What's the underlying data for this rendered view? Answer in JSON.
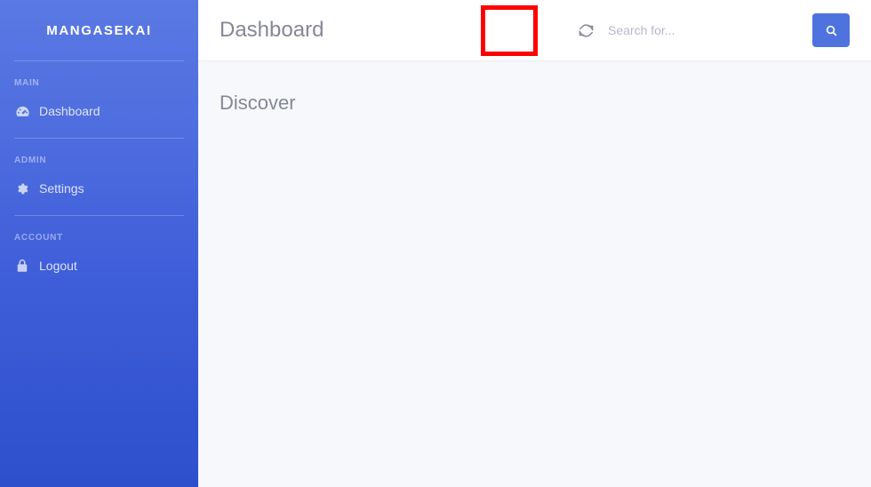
{
  "brand": {
    "name": "MANGASEKAI"
  },
  "sidebar": {
    "groups": [
      {
        "label": "MAIN",
        "items": [
          {
            "label": "Dashboard",
            "icon": "tachometer-icon"
          }
        ]
      },
      {
        "label": "ADMIN",
        "items": [
          {
            "label": "Settings",
            "icon": "gear-icon"
          }
        ]
      },
      {
        "label": "ACCOUNT",
        "items": [
          {
            "label": "Logout",
            "icon": "lock-icon"
          }
        ]
      }
    ]
  },
  "topbar": {
    "title": "Dashboard",
    "refresh_icon": "refresh-icon",
    "search": {
      "value": "",
      "placeholder": "Search for...",
      "button_icon": "search-icon"
    }
  },
  "main": {
    "heading": "Discover"
  },
  "annotation": {
    "target": "refresh-button",
    "color": "#fe0000"
  },
  "colors": {
    "sidebar_top": "#5a79e3",
    "sidebar_bottom": "#2d50cd",
    "accent": "#4e73df",
    "content_bg": "#f7f8fc",
    "muted_text": "#858796",
    "highlight": "#fe0000"
  }
}
